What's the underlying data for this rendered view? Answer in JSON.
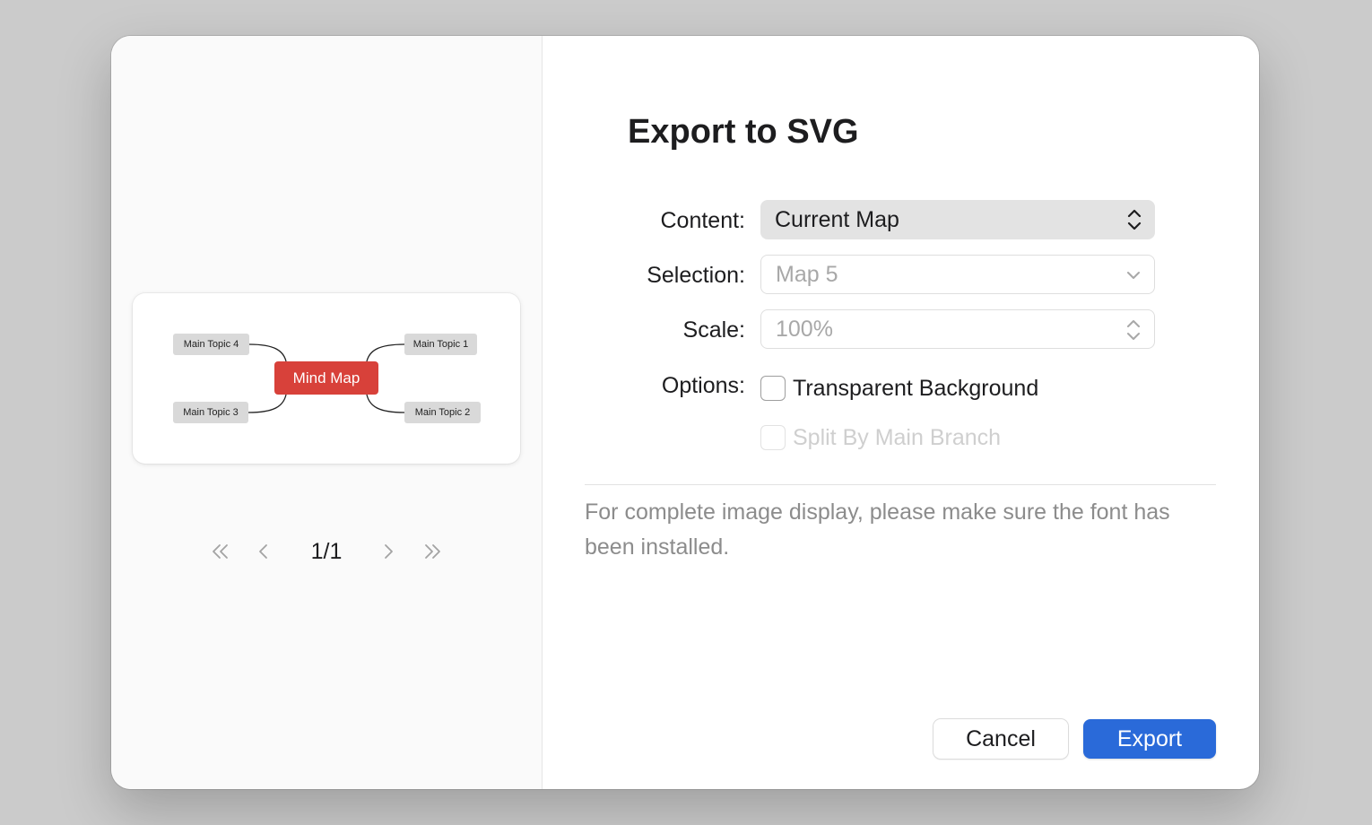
{
  "preview": {
    "central_topic": "Mind Map",
    "topics": [
      "Main Topic 1",
      "Main Topic 2",
      "Main Topic 3",
      "Main Topic 4"
    ]
  },
  "pager": {
    "page_label": "1/1",
    "icons": [
      "double-chevron-left-icon",
      "chevron-left-icon",
      "chevron-right-icon",
      "double-chevron-right-icon"
    ]
  },
  "dialog": {
    "title": "Export to SVG",
    "content": {
      "label": "Content:",
      "value": "Current Map"
    },
    "selection": {
      "label": "Selection:",
      "value": "Map 5"
    },
    "scale": {
      "label": "Scale:",
      "value": "100%"
    },
    "options": {
      "label": "Options:",
      "transparent_background": {
        "label": "Transparent Background",
        "checked": false
      },
      "split_by_main_branch": {
        "label": "Split By Main Branch",
        "checked": false
      }
    },
    "note": "For complete image display, please make sure the font has been installed.",
    "cancel_label": "Cancel",
    "export_label": "Export"
  },
  "colors": {
    "central_topic": "#d8413a",
    "subtopic_bg": "#d9d9d9",
    "primary_button": "#2a6ad9"
  }
}
